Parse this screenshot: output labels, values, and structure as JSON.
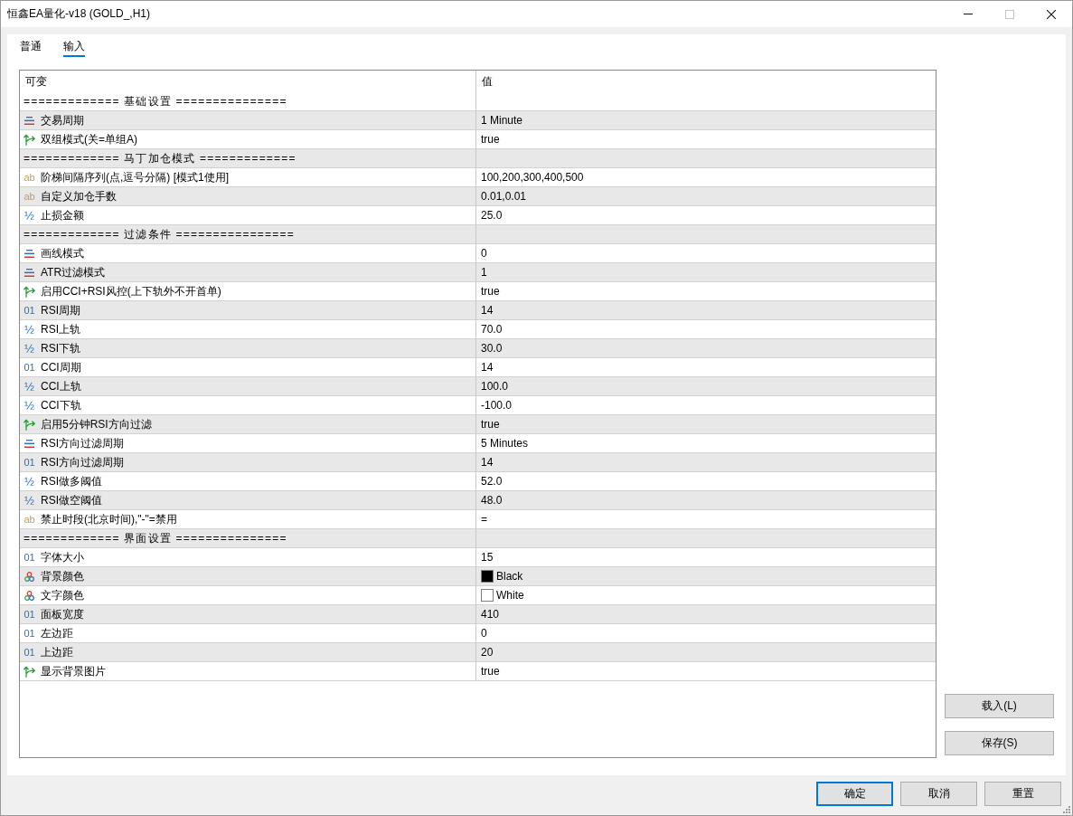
{
  "window": {
    "title": "恒鑫EA量化-v18 (GOLD_,H1)",
    "controls": [
      {
        "kind": "minimize",
        "disabled": false
      },
      {
        "kind": "maximize",
        "disabled": true
      },
      {
        "kind": "close",
        "disabled": false
      }
    ]
  },
  "tabs": [
    {
      "label": "普通",
      "selected": false
    },
    {
      "label": "输入",
      "selected": true
    }
  ],
  "table": {
    "columns": [
      "可变",
      "值"
    ],
    "rows": [
      {
        "kind": "separator",
        "label": "============= 基础设置 ==============="
      },
      {
        "kind": "enum",
        "name": "交易周期",
        "value": "1 Minute"
      },
      {
        "kind": "bool",
        "name": "双组模式(关=单组A)",
        "value": "true"
      },
      {
        "kind": "separator",
        "label": "============= 马丁加仓模式 ============="
      },
      {
        "kind": "string",
        "glyph": "ab",
        "name": "阶梯间隔序列(点,逗号分隔) [模式1使用]",
        "value": "100,200,300,400,500"
      },
      {
        "kind": "string",
        "glyph": "ab",
        "name": "自定义加仓手数",
        "value": "0.01,0.01"
      },
      {
        "kind": "double",
        "glyph": "½",
        "name": "止损金额",
        "value": "25.0"
      },
      {
        "kind": "separator",
        "label": "============= 过滤条件 ================"
      },
      {
        "kind": "enum",
        "name": "画线模式",
        "value": "0"
      },
      {
        "kind": "enum",
        "name": "ATR过滤模式",
        "value": "1"
      },
      {
        "kind": "bool",
        "name": "启用CCI+RSI风控(上下轨外不开首单)",
        "value": "true"
      },
      {
        "kind": "int",
        "glyph": "01",
        "name": "RSI周期",
        "value": "14"
      },
      {
        "kind": "double",
        "glyph": "½",
        "name": "RSI上轨",
        "value": "70.0"
      },
      {
        "kind": "double",
        "glyph": "½",
        "name": "RSI下轨",
        "value": "30.0"
      },
      {
        "kind": "int",
        "glyph": "01",
        "name": "CCI周期",
        "value": "14"
      },
      {
        "kind": "double",
        "glyph": "½",
        "name": "CCI上轨",
        "value": "100.0"
      },
      {
        "kind": "double",
        "glyph": "½",
        "name": "CCI下轨",
        "value": "-100.0"
      },
      {
        "kind": "bool",
        "name": "启用5分钟RSI方向过滤",
        "value": "true"
      },
      {
        "kind": "enum",
        "name": "RSI方向过滤周期",
        "value": "5 Minutes"
      },
      {
        "kind": "int",
        "glyph": "01",
        "name": "RSI方向过滤周期",
        "value": "14"
      },
      {
        "kind": "double",
        "glyph": "½",
        "name": "RSI做多阈值",
        "value": "52.0"
      },
      {
        "kind": "double",
        "glyph": "½",
        "name": "RSI做空阈值",
        "value": "48.0"
      },
      {
        "kind": "string",
        "glyph": "ab",
        "name": "禁止时段(北京时间),\"-\"=禁用",
        "value": "="
      },
      {
        "kind": "separator",
        "label": "============= 界面设置 ==============="
      },
      {
        "kind": "int",
        "glyph": "01",
        "name": "字体大小",
        "value": "15"
      },
      {
        "kind": "color",
        "name": "背景颜色",
        "value": "Black",
        "color": "#000000"
      },
      {
        "kind": "color",
        "name": "文字颜色",
        "value": "White",
        "color": "#ffffff"
      },
      {
        "kind": "int",
        "glyph": "01",
        "name": "面板宽度",
        "value": "410"
      },
      {
        "kind": "int",
        "glyph": "01",
        "name": "左边距",
        "value": "0"
      },
      {
        "kind": "int",
        "glyph": "01",
        "name": "上边距",
        "value": "20"
      },
      {
        "kind": "bool",
        "name": "显示背景图片",
        "value": "true"
      }
    ]
  },
  "side_buttons": [
    "载入(L)",
    "保存(S)"
  ],
  "footer_buttons": [
    {
      "label": "确定",
      "focused": true
    },
    {
      "label": "取消",
      "focused": false
    },
    {
      "label": "重置",
      "focused": false
    }
  ]
}
